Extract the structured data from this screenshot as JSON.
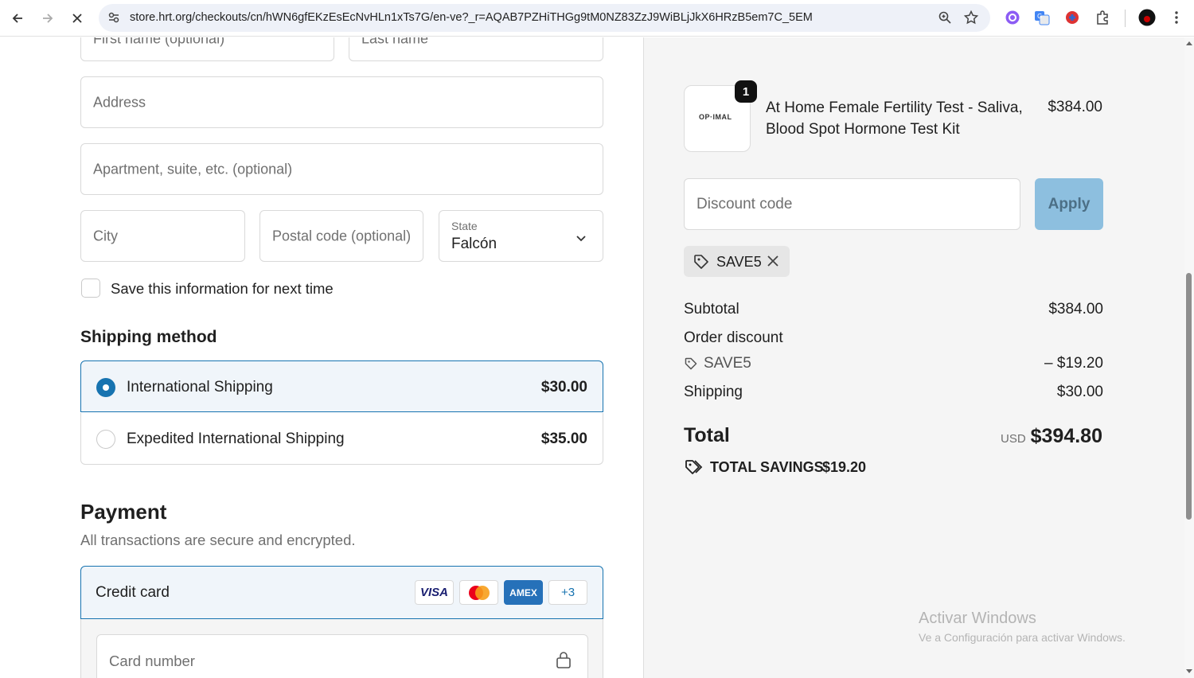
{
  "browser": {
    "url": "store.hrt.org/checkouts/cn/hWN6gfEKzEsEcNvHLn1xTs7G/en-ve?_r=AQAB7PZHiTHGg9tM0NZ83ZzJ9WiBLjJkX6HRzB5em7C_5EM"
  },
  "address": {
    "first_name_placeholder": "First name (optional)",
    "last_name_placeholder": "Last name",
    "address_placeholder": "Address",
    "apartment_placeholder": "Apartment, suite, etc. (optional)",
    "city_placeholder": "City",
    "postal_placeholder": "Postal code (optional)",
    "state_label": "State",
    "state_value": "Falcón",
    "save_info_label": "Save this information for next time"
  },
  "shipping": {
    "title": "Shipping method",
    "options": [
      {
        "name": "International Shipping",
        "price": "$30.00",
        "selected": true
      },
      {
        "name": "Expedited International Shipping",
        "price": "$35.00",
        "selected": false
      }
    ]
  },
  "payment": {
    "title": "Payment",
    "subtitle": "All transactions are secure and encrypted.",
    "method_label": "Credit card",
    "card_brands": [
      "VISA",
      "AMEX"
    ],
    "more_cards": "+3",
    "card_number_placeholder": "Card number"
  },
  "summary": {
    "product": {
      "name": "At Home Female Fertility Test - Saliva, Blood Spot Hormone Test Kit",
      "price": "$384.00",
      "quantity": "1",
      "logo_text": "OP·IMAL"
    },
    "discount_placeholder": "Discount code",
    "apply_label": "Apply",
    "applied_code": "SAVE5",
    "subtotal_label": "Subtotal",
    "subtotal_value": "$384.00",
    "order_discount_label": "Order discount",
    "discount_code_line": "SAVE5",
    "discount_value": "– $19.20",
    "shipping_label": "Shipping",
    "shipping_value": "$30.00",
    "total_label": "Total",
    "currency": "USD",
    "total_value": "$394.80",
    "savings_label": "TOTAL SAVINGS",
    "savings_value": "$19.20"
  },
  "watermark": {
    "title": "Activar Windows",
    "subtitle": "Ve a Configuración para activar Windows."
  },
  "colors": {
    "accent": "#1773b0",
    "selected_bg": "#f0f5fa",
    "apply_disabled": "#8dbfdf",
    "summary_bg": "#f5f5f5"
  }
}
